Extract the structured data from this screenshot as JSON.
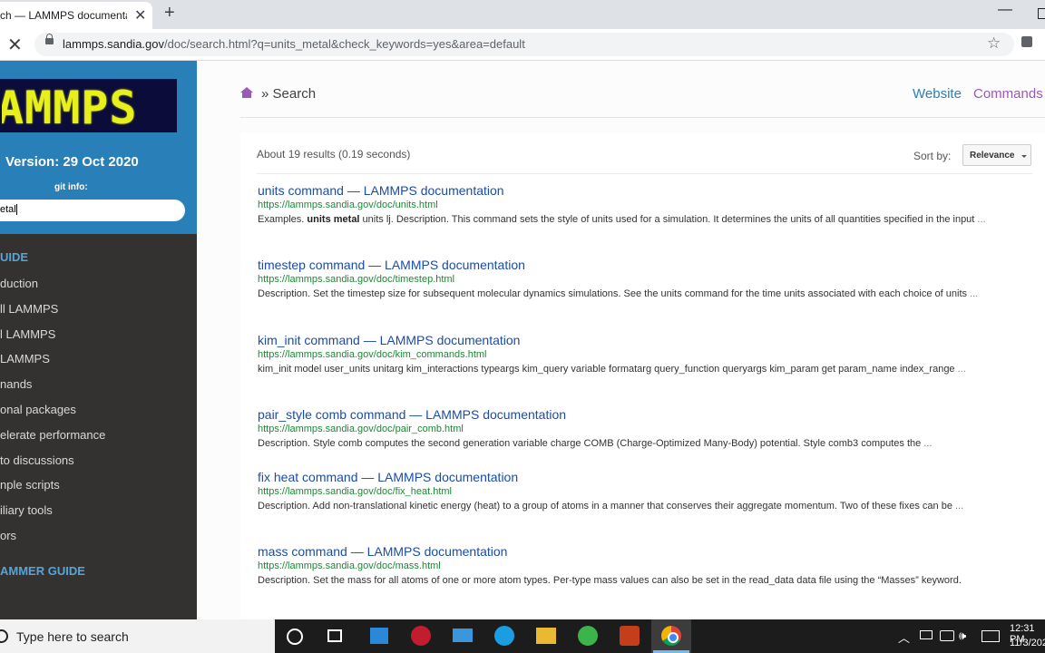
{
  "browser": {
    "tab_title": "ch — LAMMPS documentation",
    "close_tab_glyph": "✕",
    "new_tab_glyph": "+",
    "minimize_glyph": "—",
    "stop_glyph": "✕",
    "url_host": "lammps.sandia.gov",
    "url_rest": "/doc/search.html?q=units_metal&check_keywords=yes&area=default",
    "star_glyph": "☆"
  },
  "sidebar": {
    "logo_text": "AMMPS",
    "version": "Version: 29 Oct 2020",
    "git_info": "git info:",
    "search_value": "etal",
    "caption_user": "UIDE",
    "items": [
      "duction",
      "ll LAMMPS",
      "l LAMMPS",
      "LAMMPS",
      "nands",
      "onal packages",
      "elerate performance",
      "to discussions",
      "nple scripts",
      "iliary tools",
      "ors"
    ],
    "caption_programmer": "AMMER GUIDE"
  },
  "header": {
    "home_icon": "home-icon",
    "crumb": "» Search",
    "website": "Website",
    "commands": "Commands"
  },
  "search": {
    "summary": "About 19 results (0.19 seconds)",
    "sort_label": "Sort by:",
    "sort_value": "Relevance"
  },
  "results": [
    {
      "title": "units command — LAMMPS documentation",
      "url": "https://lammps.sandia.gov/doc/units.html",
      "snippet_pre": "Examples. ",
      "snippet_bold": "units metal",
      "snippet_post": " units lj. Description. This command sets the style of units used for a simulation. It determines the units of all quantities specified in the input ",
      "more": "..."
    },
    {
      "title": "timestep command — LAMMPS documentation",
      "url": "https://lammps.sandia.gov/doc/timestep.html",
      "snippet_pre": "Description. Set the timestep size for subsequent molecular dynamics simulations. See the units command for the time units associated with each choice of units ",
      "snippet_bold": "",
      "snippet_post": "",
      "more": "..."
    },
    {
      "title": "kim_init command — LAMMPS documentation",
      "url": "https://lammps.sandia.gov/doc/kim_commands.html",
      "snippet_pre": "kim_init model user_units unitarg kim_interactions typeargs kim_query variable formatarg query_function queryargs kim_param get param_name index_range ",
      "snippet_bold": "",
      "snippet_post": "",
      "more": "..."
    },
    {
      "title": "pair_style comb command — LAMMPS documentation",
      "url": "https://lammps.sandia.gov/doc/pair_comb.html",
      "snippet_pre": "Description. Style comb computes the second generation variable charge COMB (Charge-Optimized Many-Body) potential. Style comb3 computes the ",
      "snippet_bold": "",
      "snippet_post": "",
      "more": "..."
    },
    {
      "title": "fix heat command — LAMMPS documentation",
      "url": "https://lammps.sandia.gov/doc/fix_heat.html",
      "snippet_pre": "Description. Add non-translational kinetic energy (heat) to a group of atoms in a manner that conserves their aggregate momentum. Two of these fixes can be ",
      "snippet_bold": "",
      "snippet_post": "",
      "more": "..."
    },
    {
      "title": "mass command — LAMMPS documentation",
      "url": "https://lammps.sandia.gov/doc/mass.html",
      "snippet_pre": "Description. Set the mass for all atoms of one or more atom types. Per-type mass values can also be set in the read_data data file using the “Masses” keyword.",
      "snippet_bold": "",
      "snippet_post": "",
      "more": ""
    }
  ],
  "taskbar": {
    "search_placeholder": "Type here to search",
    "tray_up": "︿",
    "tray_volume": "🕪",
    "time": "12:31 PM",
    "date": "11/3/202"
  }
}
